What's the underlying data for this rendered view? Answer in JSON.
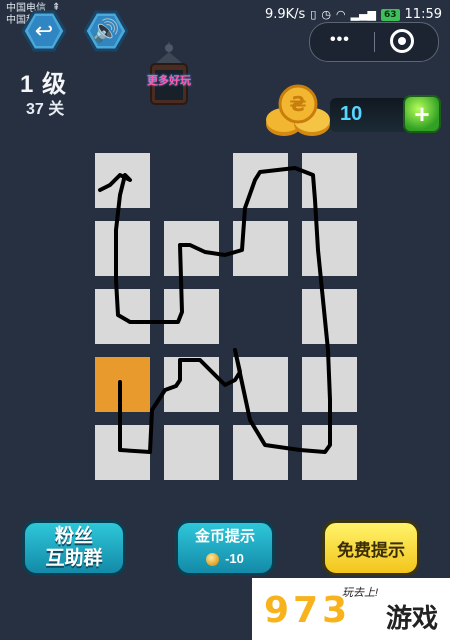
{
  "status_bar": {
    "carrier_1": "中国电信",
    "carrier_2": "中国移动",
    "usb_icon": "usb-icon",
    "net_speed": "9.9K/s",
    "battery": "63",
    "time": "11:59"
  },
  "top": {
    "back_icon": "undo-arrow-icon",
    "sound_icon": "speaker-icon",
    "more_icon": "more-dots-icon",
    "close_icon": "target-circle-icon"
  },
  "level": {
    "title": "1 级",
    "stage": "37 关"
  },
  "logo": {
    "text": "更多好玩"
  },
  "coins": {
    "count": "10",
    "add_icon": "green-gem-plus-icon"
  },
  "board": {
    "rows": 5,
    "cols": 4,
    "cells": [
      [
        1,
        0,
        1,
        1
      ],
      [
        1,
        1,
        1,
        1
      ],
      [
        1,
        1,
        0,
        1
      ],
      [
        2,
        1,
        1,
        1
      ],
      [
        1,
        1,
        1,
        1
      ]
    ],
    "colors": {
      "cell": "#d9d9d9",
      "start": "#e89a2c",
      "path": "#000000"
    }
  },
  "buttons": {
    "fans_line1": "粉丝",
    "fans_line2": "互助群",
    "coin_hint": "金币提示",
    "coin_cost": "-10",
    "free_hint": "免费提示"
  },
  "watermark": {
    "number": "973",
    "slogan": "玩去上!",
    "game": "游戏"
  }
}
